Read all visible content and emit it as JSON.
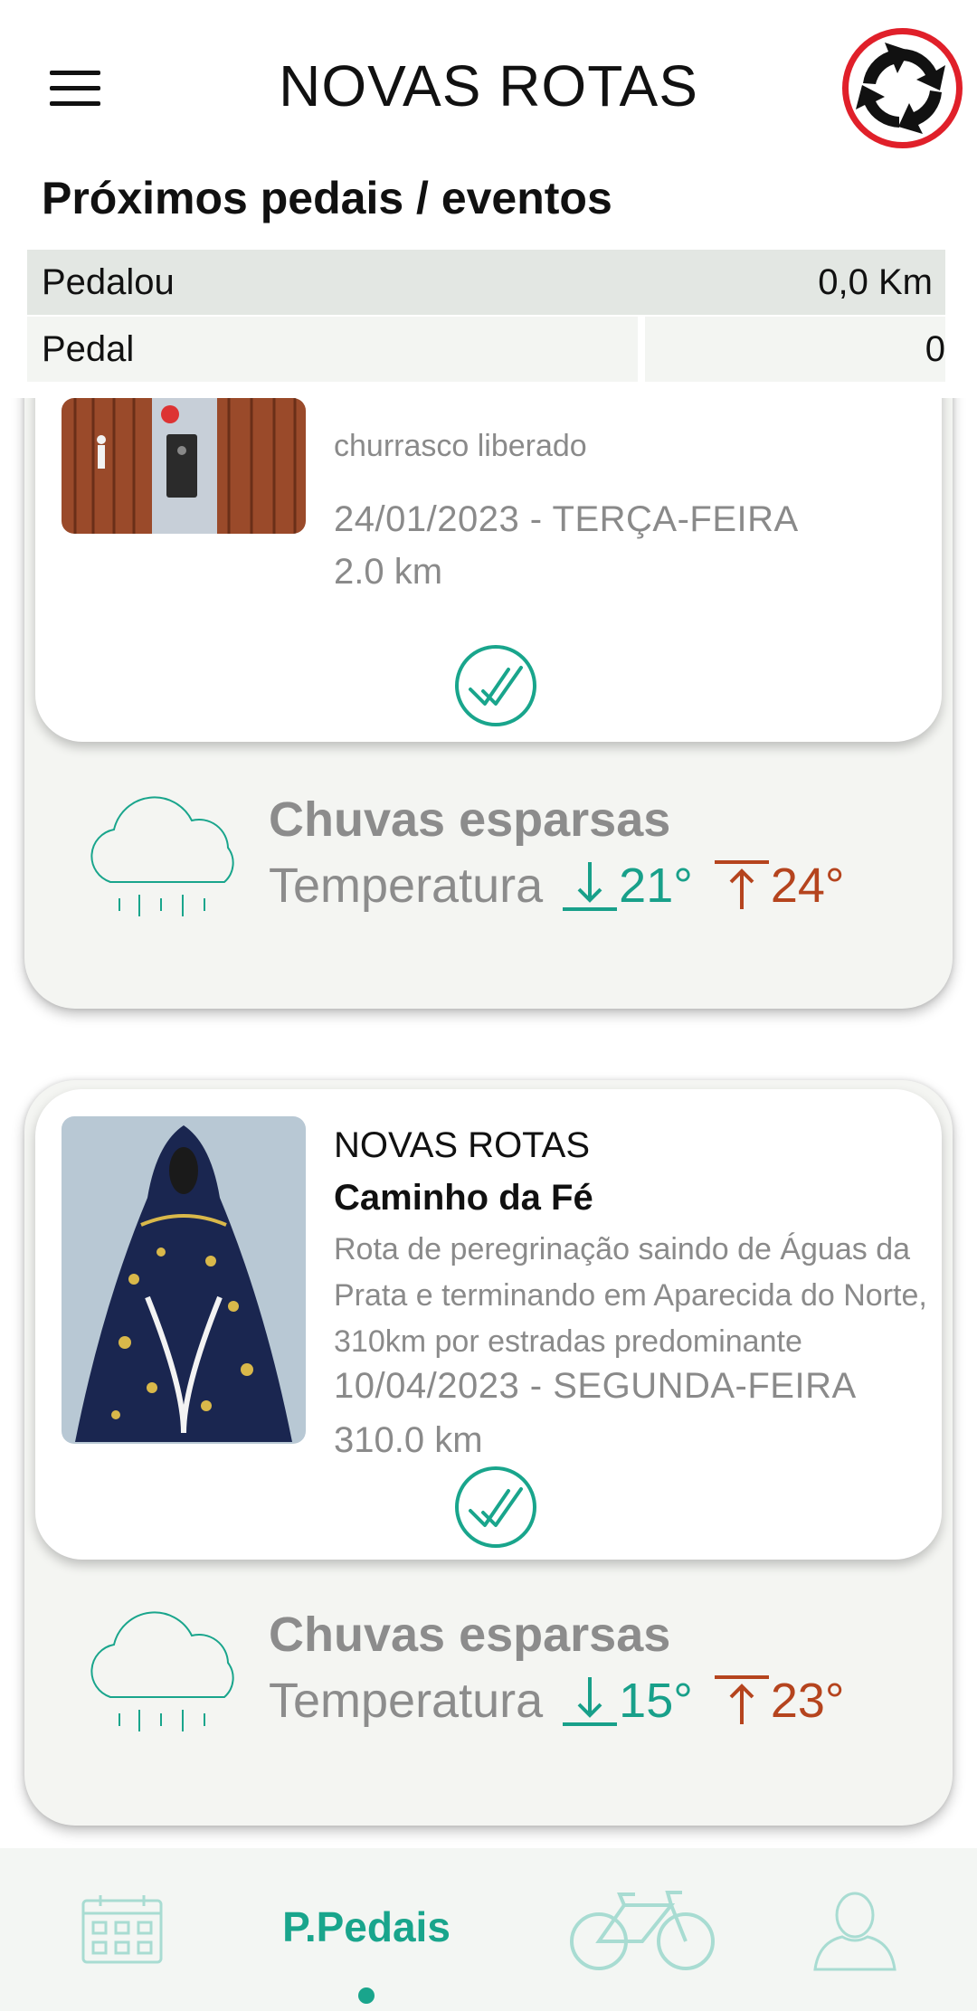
{
  "header": {
    "title": "NOVAS ROTAS",
    "menu_icon": "hamburger-menu-icon",
    "logo_icon": "roundabout-logo-icon"
  },
  "section": {
    "title": "Próximos pedais / eventos"
  },
  "stats": {
    "pedalou_label": "Pedalou",
    "pedalou_value": "0,0 Km",
    "pedal_label": "Pedal",
    "pedal_value": "0"
  },
  "events": [
    {
      "description": "churrasco liberado",
      "date": "24/01/2023 - TERÇA-FEIRA",
      "distance": "2.0 km",
      "status_icon": "double-check-icon",
      "weather": {
        "condition": "Chuvas esparsas",
        "temp_label": "Temperatura",
        "min": "21°",
        "max": "24°",
        "icon": "rain-cloud-icon"
      }
    },
    {
      "group": "NOVAS ROTAS",
      "name": "Caminho da Fé",
      "description": "Rota de peregrinação saindo de Águas da Prata e terminando em Aparecida do Norte,  310km por estradas predominante",
      "date": "10/04/2023 - SEGUNDA-FEIRA",
      "distance": "310.0 km",
      "status_icon": "double-check-icon",
      "weather": {
        "condition": "Chuvas esparsas",
        "temp_label": "Temperatura",
        "min": "15°",
        "max": "23°",
        "icon": "rain-cloud-icon"
      }
    }
  ],
  "bottom_nav": {
    "items": [
      {
        "icon": "calendar-icon"
      },
      {
        "label": "P.Pedais",
        "active": true
      },
      {
        "icon": "bicycle-icon"
      },
      {
        "icon": "user-profile-icon"
      }
    ]
  },
  "colors": {
    "accent": "#19a58c",
    "temp_max": "#b5441e",
    "muted_text": "#8a8a8a",
    "logo_red": "#e0202a"
  }
}
